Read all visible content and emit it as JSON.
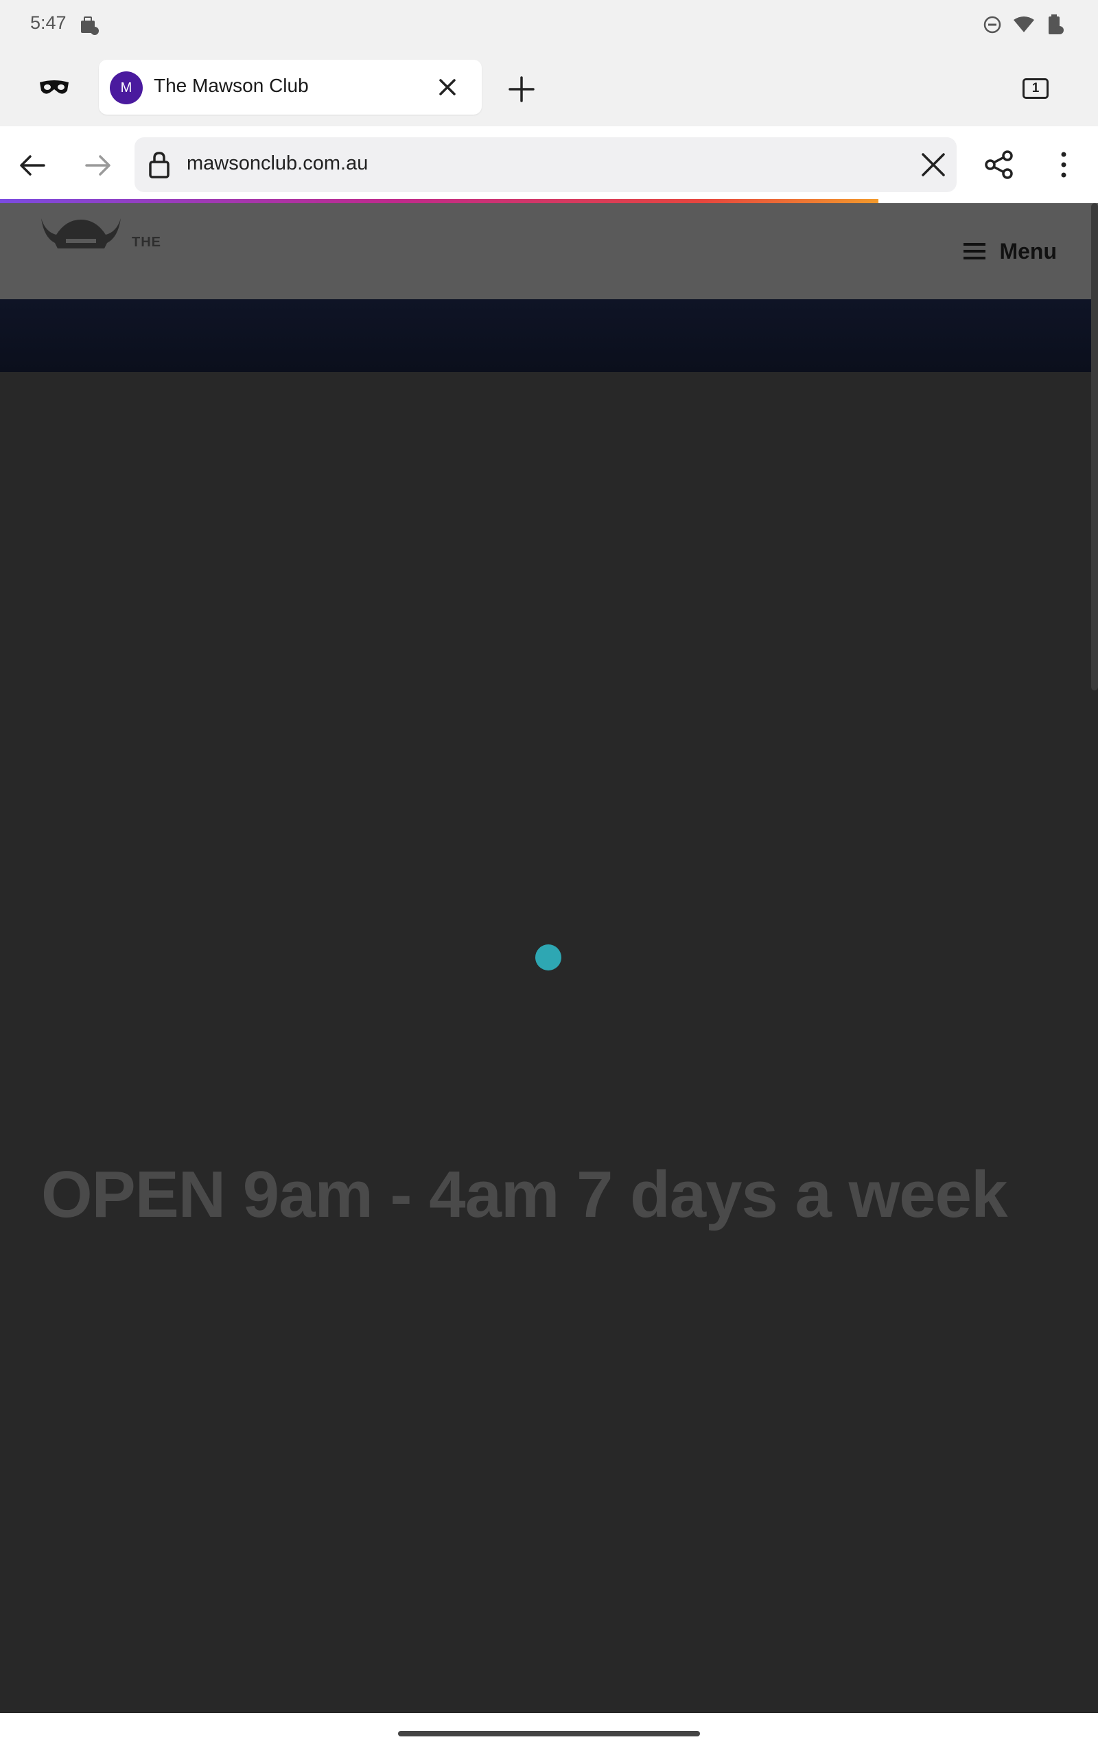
{
  "status_bar": {
    "time": "5:47"
  },
  "tabs": {
    "active_tab": {
      "favicon_letter": "M",
      "title": "The Mawson Club"
    },
    "tab_count": "1"
  },
  "toolbar": {
    "url": "mawsonclub.com.au"
  },
  "page": {
    "logo_text": "THE",
    "menu_label": "Menu",
    "hours_text": "OPEN 9am - 4am 7 days a week"
  },
  "load_progress": 0.8,
  "colors": {
    "favicon_bg": "#4a1a9e",
    "loader_dot": "#2ea7b3",
    "page_bg": "#282828",
    "header_bg": "#5a5a5a"
  },
  "icons": {
    "private": "incognito-mask-icon",
    "close_tab": "close-icon",
    "new_tab": "plus-icon",
    "back": "arrow-left-icon",
    "forward": "arrow-right-icon",
    "lock": "lock-icon",
    "clear": "close-icon",
    "share": "share-icon",
    "more": "more-vertical-icon",
    "menu": "hamburger-icon"
  }
}
